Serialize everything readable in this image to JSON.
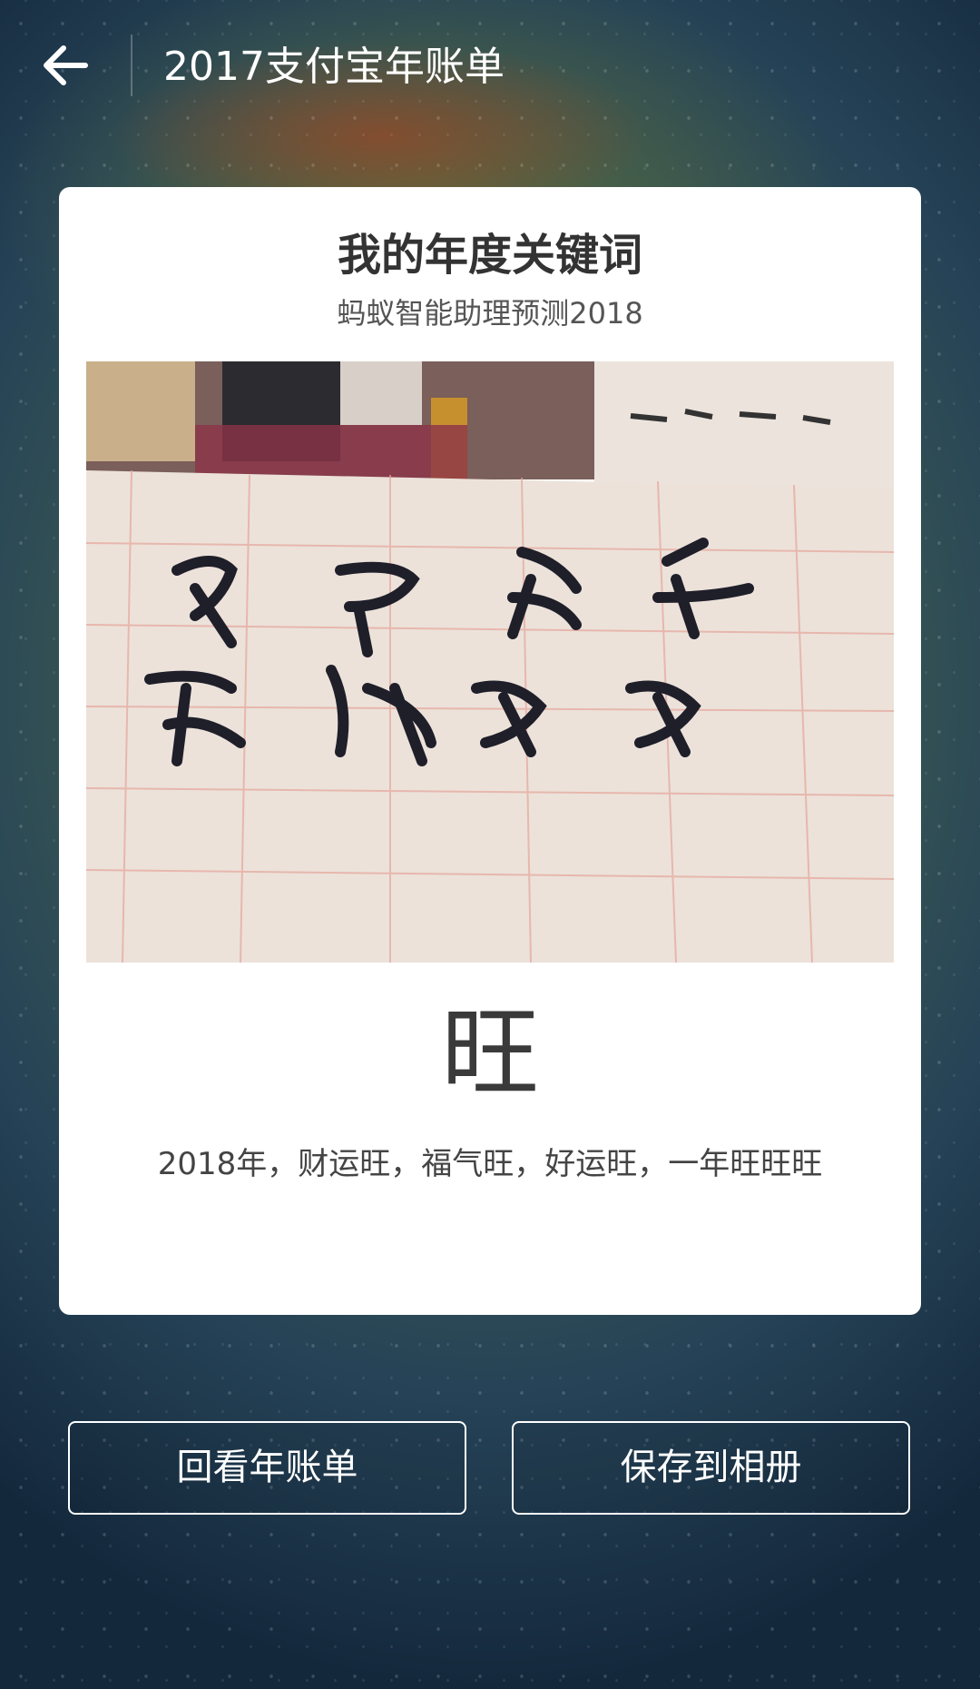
{
  "header": {
    "back_icon": "arrow-left-icon",
    "title": "2017支付宝年账单"
  },
  "card": {
    "title": "我的年度关键词",
    "subtitle": "蚂蚁智能助理预测2018",
    "photo_alt": "calligraphy-photo",
    "keyword": "旺",
    "description": "2018年，财运旺，福气旺，好运旺，一年旺旺旺"
  },
  "actions": {
    "review_label": "回看年账单",
    "save_label": "保存到相册"
  },
  "colors": {
    "card_bg": "#ffffff",
    "title_text": "#333333",
    "button_border": "#ffffff"
  }
}
